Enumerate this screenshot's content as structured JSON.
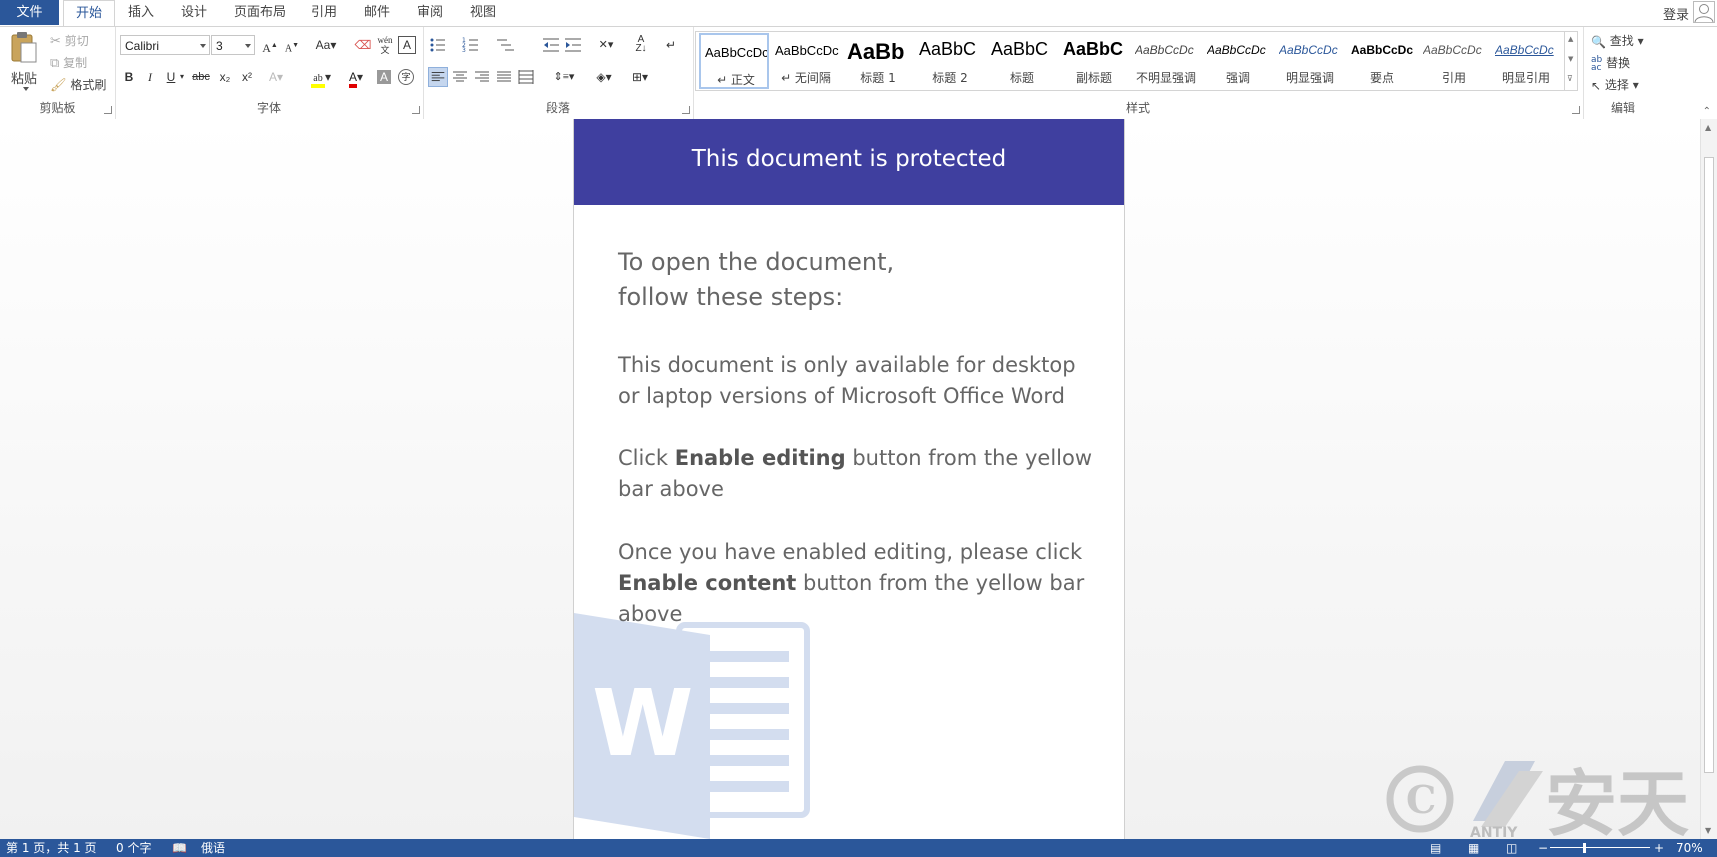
{
  "tabs": {
    "file": "文件",
    "home": "开始",
    "insert": "插入",
    "design": "设计",
    "layout": "页面布局",
    "references": "引用",
    "mailings": "邮件",
    "review": "审阅",
    "view": "视图"
  },
  "account": {
    "login": "登录"
  },
  "clipboard": {
    "paste": "粘贴",
    "cut": "剪切",
    "copy": "复制",
    "format_painter": "格式刷",
    "label": "剪贴板"
  },
  "font": {
    "name": "Calibri",
    "size": "3",
    "label": "字体",
    "change_case": "Aa",
    "bold": "B",
    "italic": "I",
    "underline": "U",
    "strike": "abc",
    "subscript": "x₂",
    "superscript": "x²"
  },
  "paragraph": {
    "label": "段落"
  },
  "styles": {
    "label": "样式",
    "items": [
      {
        "sample": "AaBbCcDc",
        "name": "↵ 正文"
      },
      {
        "sample": "AaBbCcDc",
        "name": "↵ 无间隔"
      },
      {
        "sample": "AaBb",
        "name": "标题 1"
      },
      {
        "sample": "AaBbC",
        "name": "标题 2"
      },
      {
        "sample": "AaBbC",
        "name": "标题"
      },
      {
        "sample": "AaBbC",
        "name": "副标题"
      },
      {
        "sample": "AaBbCcDc",
        "name": "不明显强调"
      },
      {
        "sample": "AaBbCcDc",
        "name": "强调"
      },
      {
        "sample": "AaBbCcDc",
        "name": "明显强调"
      },
      {
        "sample": "AaBbCcDc",
        "name": "要点"
      },
      {
        "sample": "AaBbCcDc",
        "name": "引用"
      },
      {
        "sample": "AaBbCcDc",
        "name": "明显引用"
      }
    ]
  },
  "editing": {
    "find": "查找",
    "replace": "替换",
    "select": "选择",
    "label": "编辑"
  },
  "document": {
    "banner": "This document is protected",
    "heading_line1": "To open the document,",
    "heading_line2": "follow these steps:",
    "para1": "This document is only available for desktop or laptop versions of Microsoft Office Word",
    "para2_pre": "Click ",
    "para2_bold": "Enable editing",
    "para2_post": " button from the yellow bar above",
    "para3_pre": "Once you have enabled editing, please click ",
    "para3_bold": "Enable content",
    "para3_post": " button from the yellow bar above",
    "logo_letter": "W"
  },
  "watermark": {
    "text": "安天",
    "sub": "ANTIY"
  },
  "status": {
    "page": "第 1 页，共 1 页",
    "words": "0 个字",
    "language": "俄语",
    "zoom": "70%"
  },
  "colors": {
    "accent": "#2b579a",
    "banner": "#3f3f9f"
  }
}
